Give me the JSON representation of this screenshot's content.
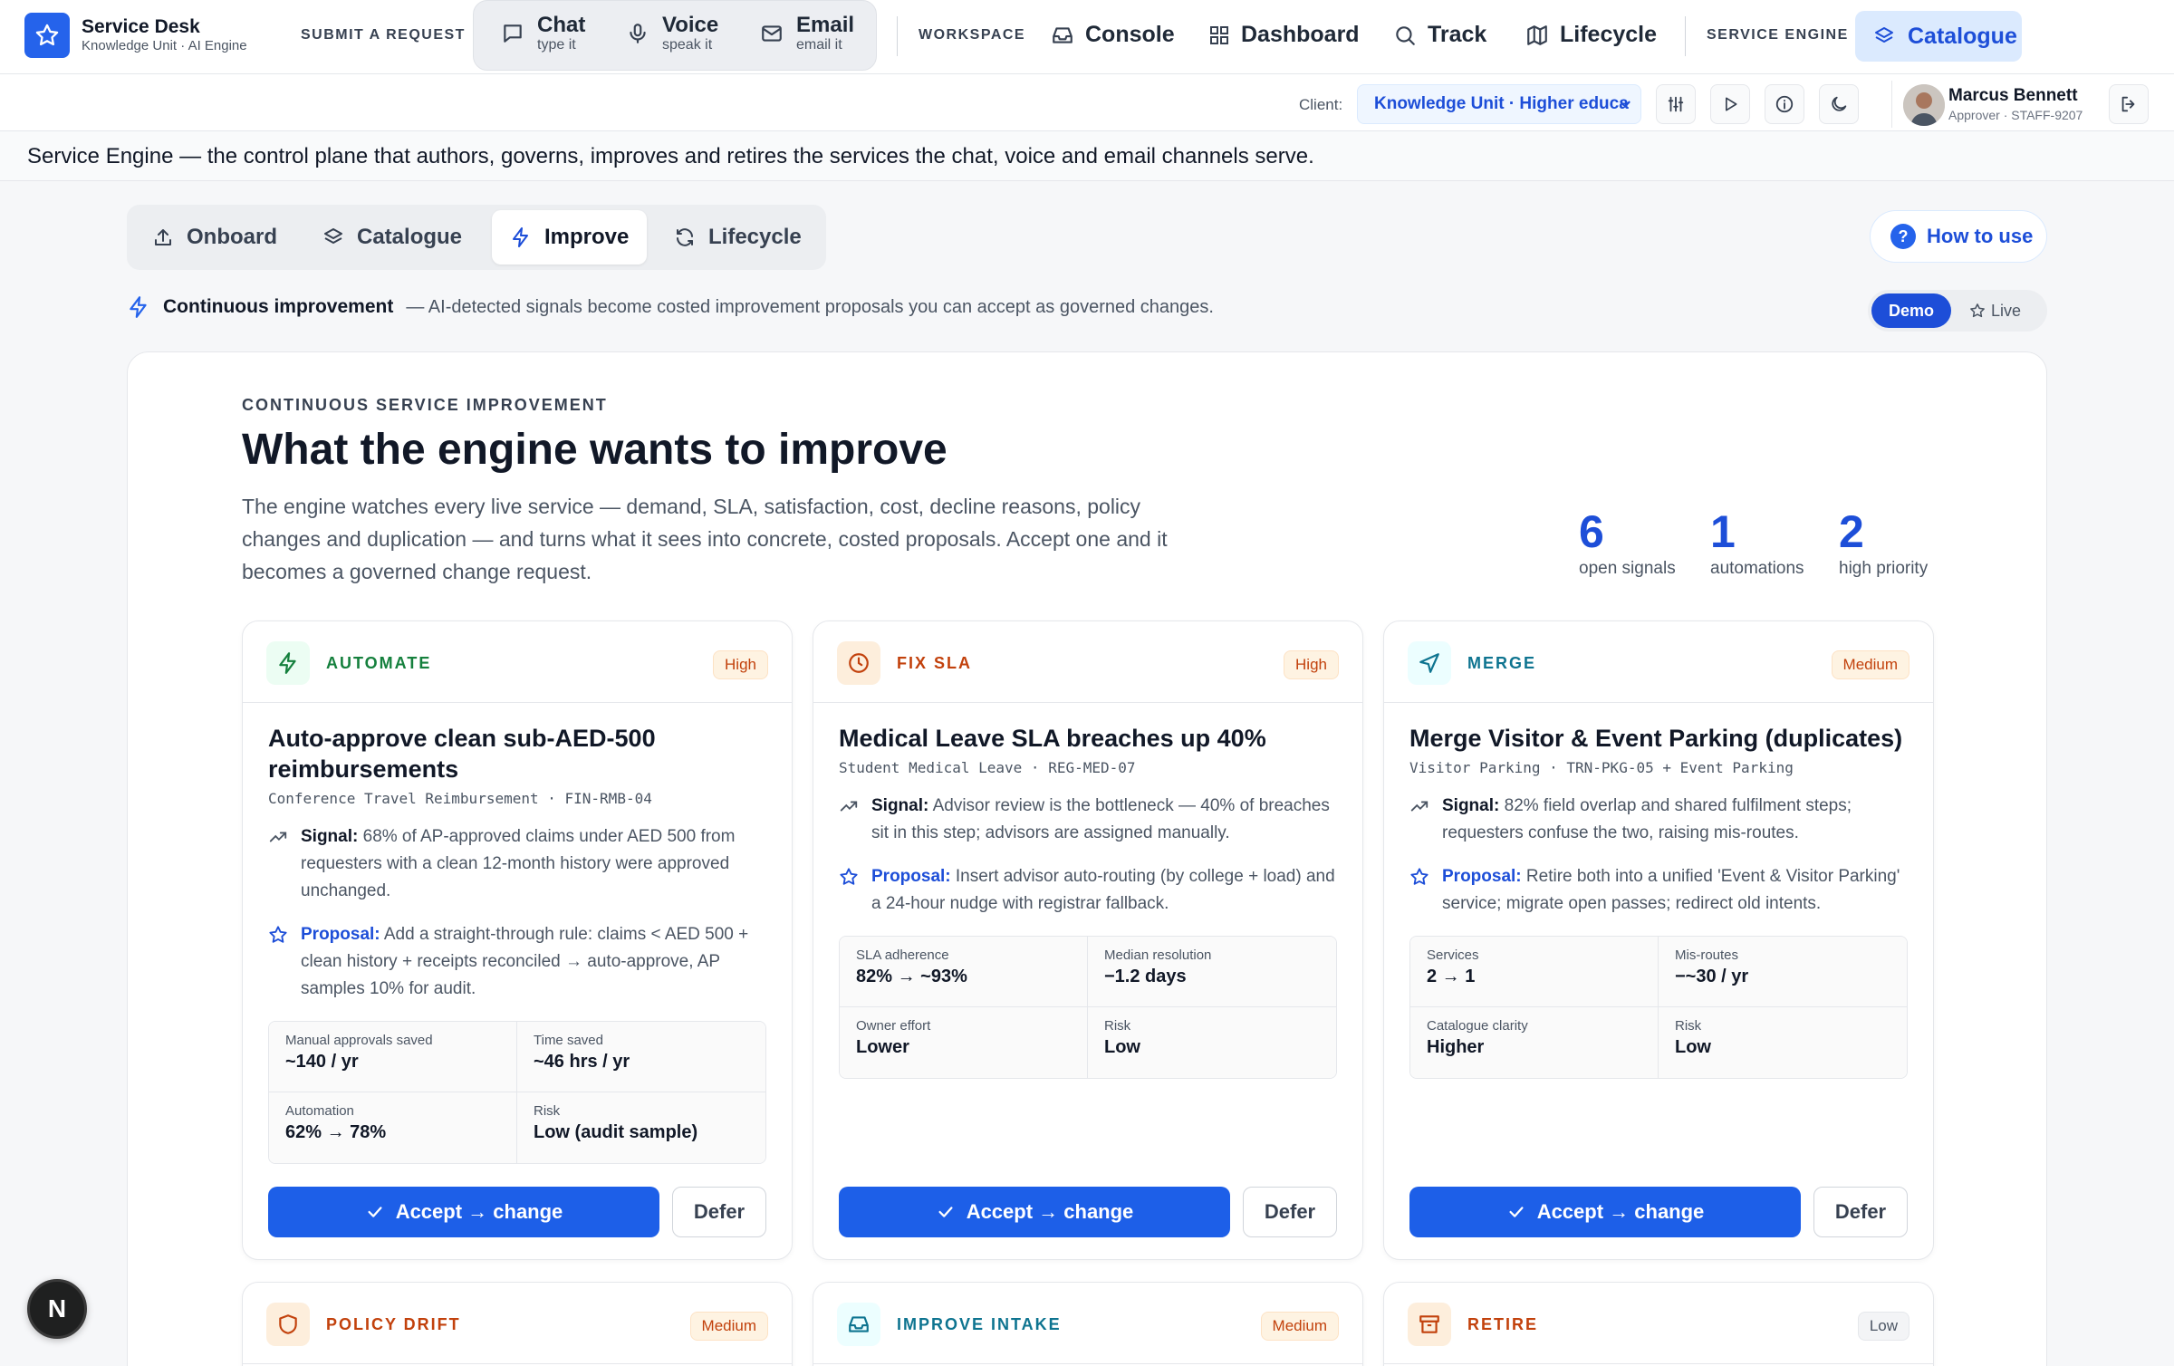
{
  "brand": {
    "title": "Service Desk",
    "subtitle": "Knowledge Unit · AI Engine"
  },
  "topnav": {
    "submit_caption": "SUBMIT A REQUEST",
    "channels": [
      {
        "label": "Chat",
        "sub": "type it",
        "icon": "chat-bubble-icon"
      },
      {
        "label": "Voice",
        "sub": "speak it",
        "icon": "microphone-icon"
      },
      {
        "label": "Email",
        "sub": "email it",
        "icon": "envelope-icon"
      }
    ],
    "workspace_caption": "WORKSPACE",
    "workspace_links": [
      {
        "label": "Console",
        "icon": "inbox-icon"
      },
      {
        "label": "Dashboard",
        "icon": "grid-icon"
      },
      {
        "label": "Track",
        "icon": "search-icon"
      },
      {
        "label": "Lifecycle",
        "icon": "map-icon"
      }
    ],
    "engine_caption": "SERVICE ENGINE",
    "engine_active": {
      "label": "Catalogue",
      "icon": "layers-icon"
    }
  },
  "subbar": {
    "client_label": "Client:",
    "client_value": "Knowledge Unit · Higher educa",
    "icons": [
      "sliders-icon",
      "play-icon",
      "info-icon",
      "moon-icon",
      "logout-icon"
    ],
    "user": {
      "name": "Marcus Bennett",
      "role": "Approver · STAFF-9207"
    }
  },
  "description": "Service Engine — the control plane that authors, governs, improves and retires the services the chat, voice and email channels serve.",
  "tabs": [
    {
      "label": "Onboard",
      "icon": "upload-icon",
      "active": false
    },
    {
      "label": "Catalogue",
      "icon": "layers-icon",
      "active": false
    },
    {
      "label": "Improve",
      "icon": "bolt-icon",
      "active": true
    },
    {
      "label": "Lifecycle",
      "icon": "refresh-icon",
      "active": false
    }
  ],
  "how_to_use": {
    "label": "How to use",
    "glyph": "?"
  },
  "ci": {
    "title": "Continuous improvement",
    "desc": "— AI-detected signals become costed improvement proposals you can accept as governed changes."
  },
  "mode": {
    "demo": "Demo",
    "live": "Live"
  },
  "main": {
    "eyebrow": "CONTINUOUS SERVICE IMPROVEMENT",
    "headline": "What the engine wants to improve",
    "intro": "The engine watches every live service — demand, SLA, satisfaction, cost, decline reasons, policy changes and duplication — and turns what it sees into concrete, costed proposals. Accept one and it becomes a governed change request.",
    "stats": [
      {
        "value": "6",
        "label": "open signals"
      },
      {
        "value": "1",
        "label": "automations"
      },
      {
        "value": "2",
        "label": "high priority"
      }
    ]
  },
  "labels": {
    "signal": "Signal:",
    "proposal": "Proposal:",
    "accept": "Accept → change",
    "defer": "Defer"
  },
  "cards": [
    {
      "kind": "AUTOMATE",
      "priority": "High",
      "title": "Auto-approve clean sub-AED-500 reimbursements",
      "meta": "Conference Travel Reimbursement · FIN-RMB-04",
      "signal": "68% of AP-approved claims under AED 500 from requesters with a clean 12-month history were approved unchanged.",
      "proposal": "Add a straight-through rule: claims < AED 500 + clean history + receipts reconciled → auto-approve, AP samples 10% for audit.",
      "metrics": [
        {
          "label": "Manual approvals saved",
          "value": "~140 / yr"
        },
        {
          "label": "Time saved",
          "value": "~46 hrs / yr"
        },
        {
          "label": "Automation",
          "value": "62% → 78%"
        },
        {
          "label": "Risk",
          "value": "Low (audit sample)"
        }
      ]
    },
    {
      "kind": "FIX SLA",
      "priority": "High",
      "title": "Medical Leave SLA breaches up 40%",
      "meta": "Student Medical Leave · REG-MED-07",
      "signal": "Advisor review is the bottleneck — 40% of breaches sit in this step; advisors are assigned manually.",
      "proposal": "Insert advisor auto-routing (by college + load) and a 24-hour nudge with registrar fallback.",
      "metrics": [
        {
          "label": "SLA adherence",
          "value": "82% → ~93%"
        },
        {
          "label": "Median resolution",
          "value": "−1.2 days"
        },
        {
          "label": "Owner effort",
          "value": "Lower"
        },
        {
          "label": "Risk",
          "value": "Low"
        }
      ]
    },
    {
      "kind": "MERGE",
      "priority": "Medium",
      "title": "Merge Visitor & Event Parking (duplicates)",
      "meta": "Visitor Parking · TRN-PKG-05 + Event Parking",
      "signal": "82% field overlap and shared fulfilment steps; requesters confuse the two, raising mis-routes.",
      "proposal": "Retire both into a unified 'Event & Visitor Parking' service; migrate open passes; redirect old intents.",
      "metrics": [
        {
          "label": "Services",
          "value": "2 → 1"
        },
        {
          "label": "Mis-routes",
          "value": "−~30 / yr"
        },
        {
          "label": "Catalogue clarity",
          "value": "Higher"
        },
        {
          "label": "Risk",
          "value": "Low"
        }
      ]
    },
    {
      "kind": "POLICY DRIFT",
      "priority": "Medium"
    },
    {
      "kind": "IMPROVE INTAKE",
      "priority": "Medium"
    },
    {
      "kind": "RETIRE",
      "priority": "Low"
    }
  ],
  "fab": {
    "label": "N"
  },
  "colors": {
    "accent": "#1d4ed8",
    "automate": "#15803d",
    "fix_sla": "#c2410c",
    "merge": "#0e7490",
    "policy": "#c2410c",
    "intake": "#0e7490",
    "retire": "#c2410c"
  }
}
